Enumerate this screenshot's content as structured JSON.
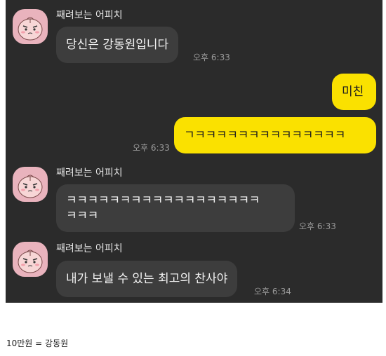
{
  "chat": {
    "background_color": "#2b2b2b",
    "incoming_bubble_color": "#3d3d3d",
    "outgoing_bubble_color": "#fae100",
    "messages": [
      {
        "direction": "incoming",
        "sender": "째려보는 어피치",
        "text": "당신은 강동원입니다",
        "time": "오후 6:33",
        "avatar_icon": "apeach-icon"
      },
      {
        "direction": "outgoing",
        "text": "미친"
      },
      {
        "direction": "outgoing",
        "text": "ㄱㅋㅋㅋㅋㅋㅋㅋㅋㅋㅋㅋㅋㅋㅋ",
        "time": "오후 6:33"
      },
      {
        "direction": "incoming",
        "sender": "째려보는 어피치",
        "text_line_1": "ㅋㅋㅋㅋㅋㅋㅋㅋㅋㅋㅋㅋㅋㅋㅋㅋㅋㅋ",
        "text_line_2": "ㅋㅋㅋ",
        "time": "오후 6:33",
        "avatar_icon": "apeach-icon"
      },
      {
        "direction": "incoming",
        "sender": "째려보는 어피치",
        "text": "내가 보낼 수 있는 최고의 찬사야",
        "time": "오후 6:34",
        "avatar_icon": "apeach-icon"
      }
    ]
  },
  "caption": "10만원 = 강동원"
}
